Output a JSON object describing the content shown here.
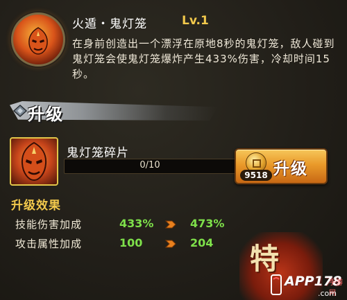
{
  "skill": {
    "icon": "flame-mask-icon",
    "title": "火遁・鬼灯笼",
    "level": "Lv.1",
    "description": "在身前创造出一个漂浮在原地8秒的鬼灯笼，敌人碰到鬼灯笼会使鬼灯笼爆炸产生433%伤害，冷却时间15秒。"
  },
  "upgrade_section": {
    "header": "升级",
    "item": {
      "icon": "ghost-lantern-shard-icon",
      "name": "鬼灯笼碎片",
      "progress_text": "0/10",
      "progress_fraction": 0.0
    },
    "button": {
      "coin_icon": "copper-coin-icon",
      "cost": "9518",
      "label": "升级"
    }
  },
  "effects": {
    "title": "升级效果",
    "rows": [
      {
        "label": "技能伤害加成",
        "from": "433%",
        "to": "473%"
      },
      {
        "label": "攻击属性加成",
        "from": "100",
        "to": "204"
      }
    ]
  },
  "decor": {
    "corner_glyph": "特",
    "watermark": {
      "main": "APP178",
      "sub": ".com",
      "cn": "手游网"
    }
  },
  "colors": {
    "level": "#f2c94c",
    "gain_value": "#7ee04a",
    "effects_title": "#f2c94c",
    "button": "#e99a2a"
  }
}
